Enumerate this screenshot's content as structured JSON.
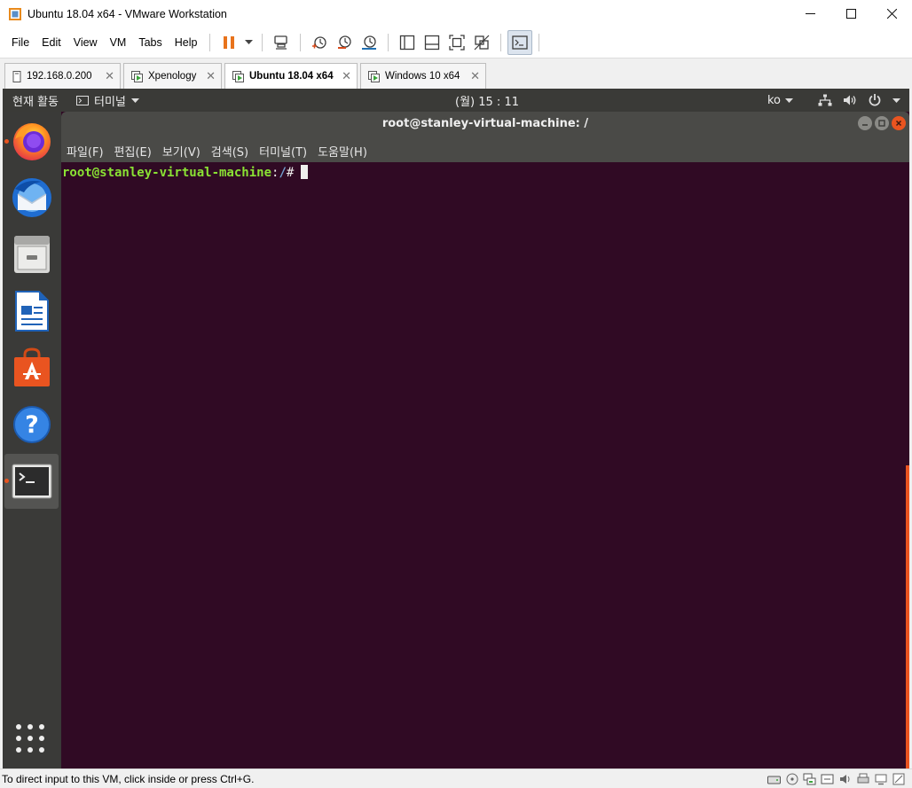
{
  "window": {
    "title": "Ubuntu 18.04 x64 - VMware Workstation",
    "controls": {
      "minimize": "─",
      "maximize": "☐",
      "close": "✕"
    }
  },
  "menu": {
    "items": [
      "File",
      "Edit",
      "View",
      "VM",
      "Tabs",
      "Help"
    ]
  },
  "toolbar": {
    "icons": [
      "pause-icon",
      "dropdown-arrow-icon",
      "send-ctrl-alt-del-icon",
      "snapshot-take-icon",
      "snapshot-revert-icon",
      "snapshot-manager-icon",
      "library-icon",
      "thumbnail-bar-icon",
      "full-screen-icon",
      "unity-icon",
      "console-view-icon"
    ]
  },
  "tabs": [
    {
      "label": "192.168.0.200",
      "active": false,
      "icon": "server-icon"
    },
    {
      "label": "Xpenology",
      "active": false,
      "icon": "vm-running-icon"
    },
    {
      "label": "Ubuntu 18.04 x64",
      "active": true,
      "icon": "vm-running-icon"
    },
    {
      "label": "Windows 10 x64",
      "active": false,
      "icon": "vm-running-icon"
    }
  ],
  "tab_close": "✕",
  "gnome": {
    "activities": "현재 활동",
    "app_menu": "터미널",
    "clock": "(월) 15 : 11",
    "lang": "ko"
  },
  "dock": {
    "apps": [
      "Firefox",
      "Thunderbird",
      "Files",
      "LibreOffice Writer",
      "Ubuntu Software",
      "Help",
      "Terminal"
    ]
  },
  "terminal": {
    "title": "root@stanley-virtual-machine: /",
    "menu": [
      "파일(F)",
      "편집(E)",
      "보기(V)",
      "검색(S)",
      "터미널(T)",
      "도움말(H)"
    ],
    "prompt_user": "root@stanley-virtual-machine",
    "prompt_sep": ":",
    "prompt_path": "/",
    "prompt_symbol": "#"
  },
  "statusbar": {
    "text": "To direct input to this VM, click inside or press Ctrl+G."
  },
  "colors": {
    "terminal_bg": "#300a24",
    "ubuntu_orange": "#e95420",
    "prompt_green": "#8ae234",
    "prompt_blue": "#729fcf"
  }
}
